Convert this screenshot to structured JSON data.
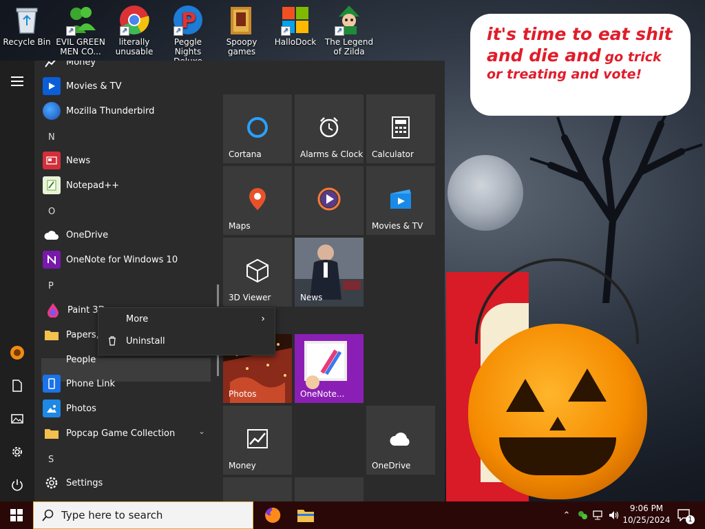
{
  "wallpaper": {
    "speech_lines": [
      "it's time to eat shit",
      "and die and",
      "go trick",
      "or treating and vote!"
    ]
  },
  "desktop_icons": [
    {
      "label": "Recycle Bin",
      "icon": "recycle-bin-icon"
    },
    {
      "label": "EVIL GREEN MEN CO...",
      "icon": "people-icon"
    },
    {
      "label": "literally unusable",
      "icon": "chrome-icon"
    },
    {
      "label": "Peggle Nights Deluxe",
      "icon": "peggle-icon"
    },
    {
      "label": "Spoopy games",
      "icon": "folder-icon"
    },
    {
      "label": "HalloDock",
      "icon": "windows-logo-icon"
    },
    {
      "label": "The Legend of Zilda",
      "icon": "game-character-icon"
    }
  ],
  "start_menu": {
    "app_list": [
      {
        "type": "app",
        "label": "Money",
        "icon": "money-chart-icon"
      },
      {
        "type": "app",
        "label": "Movies & TV",
        "icon": "movies-tv-icon"
      },
      {
        "type": "app",
        "label": "Mozilla Thunderbird",
        "icon": "thunderbird-icon"
      },
      {
        "type": "header",
        "label": "N"
      },
      {
        "type": "app",
        "label": "News",
        "icon": "news-icon"
      },
      {
        "type": "app",
        "label": "Notepad++",
        "icon": "notepad-plus-icon"
      },
      {
        "type": "header",
        "label": "O"
      },
      {
        "type": "app",
        "label": "OneDrive",
        "icon": "onedrive-cloud-icon"
      },
      {
        "type": "app",
        "label": "OneNote for Windows 10",
        "icon": "onenote-icon"
      },
      {
        "type": "header",
        "label": "P"
      },
      {
        "type": "app",
        "label": "Paint 3D",
        "icon": "paint3d-icon"
      },
      {
        "type": "app",
        "label": "Papers, P",
        "icon": "folder-icon"
      },
      {
        "type": "app",
        "label": "People",
        "icon": ""
      },
      {
        "type": "app",
        "label": "Phone Link",
        "icon": "phone-link-icon"
      },
      {
        "type": "app",
        "label": "Photos",
        "icon": "photos-icon"
      },
      {
        "type": "app",
        "label": "Popcap Game Collection",
        "icon": "folder-icon"
      },
      {
        "type": "header",
        "label": "S"
      },
      {
        "type": "app",
        "label": "Settings",
        "icon": "settings-gear-icon"
      }
    ],
    "tiles": [
      {
        "label": "Cortana",
        "icon": "cortana-icon"
      },
      {
        "label": "Alarms & Clock",
        "icon": "alarm-clock-icon"
      },
      {
        "label": "Calculator",
        "icon": "calculator-icon"
      },
      {
        "label": "Maps",
        "icon": "map-pin-icon"
      },
      {
        "label": "",
        "icon": "media-play-icon"
      },
      {
        "label": "Movies & TV",
        "icon": "movies-tv-icon"
      },
      {
        "label": "3D Viewer",
        "icon": "cube-icon"
      },
      {
        "label": "News",
        "icon": "news-photo"
      },
      {
        "label": "Photos",
        "icon": "photos-photo"
      },
      {
        "label": "OneNote...",
        "icon": "onenote-photo"
      },
      {
        "label": "Money",
        "icon": "money-chart-icon"
      },
      {
        "label": "OneDrive",
        "icon": "onedrive-cloud-icon"
      }
    ],
    "context_menu": {
      "more": "More",
      "uninstall": "Uninstall"
    }
  },
  "taskbar": {
    "search_placeholder": "Type here to search",
    "time": "9:06 PM",
    "date": "10/25/2024",
    "notification_count": "1"
  }
}
